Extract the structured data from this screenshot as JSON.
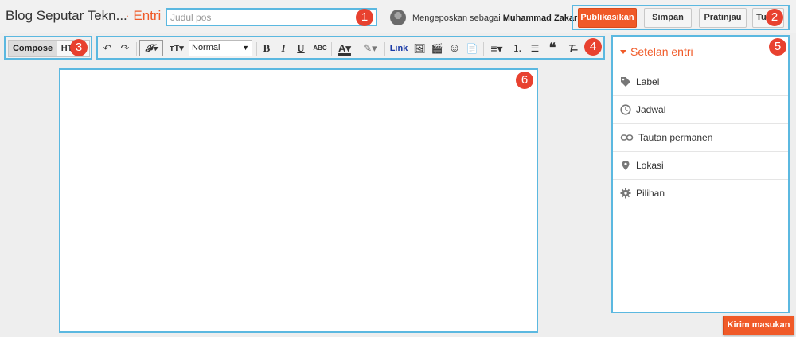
{
  "header": {
    "blog_title": "Blog Seputar Tekn...",
    "post_crumb": "· Entri",
    "title_placeholder": "Judul pos",
    "posting_as_prefix": "Mengeposkan sebagai",
    "user_name": "Muhammad Zakaria"
  },
  "actions": {
    "publish": "Publikasikan",
    "save": "Simpan",
    "preview": "Pratinjau",
    "close": "Tutup"
  },
  "modes": {
    "compose": "Compose",
    "html": "HTML"
  },
  "toolbar": {
    "undo_icon": "↶",
    "redo_icon": "↷",
    "font_icon": "𝓕▾",
    "font_size_icon": "ᴛT▾",
    "format_value": "Normal",
    "bold": "B",
    "italic": "I",
    "underline": "U",
    "strikethrough": "ABC",
    "text_color": "A▾",
    "highlight": "✎▾",
    "link": "Link",
    "image_icon": "🖼",
    "video_icon": "🎬",
    "emoji_icon": "☺",
    "jump_break_icon": "📄",
    "align_icon": "≡▾",
    "numbered_list_icon": "⒈",
    "bullet_list_icon": "☰",
    "quote_icon": "❝",
    "clear_format_icon": "T̶"
  },
  "sidebar": {
    "heading": "Setelan entri",
    "items": [
      {
        "label": "Label",
        "icon": "tag-icon"
      },
      {
        "label": "Jadwal",
        "icon": "clock-icon"
      },
      {
        "label": "Tautan permanen",
        "icon": "link-icon"
      },
      {
        "label": "Lokasi",
        "icon": "location-pin-icon"
      },
      {
        "label": "Pilihan",
        "icon": "gear-icon"
      }
    ]
  },
  "feedback": {
    "label": "Kirim masukan"
  },
  "annotations": [
    "1",
    "2",
    "3",
    "4",
    "5",
    "6"
  ],
  "colors": {
    "accent": "#f05a28",
    "highlight_border": "#5bb8e0",
    "badge": "#e8412f"
  }
}
